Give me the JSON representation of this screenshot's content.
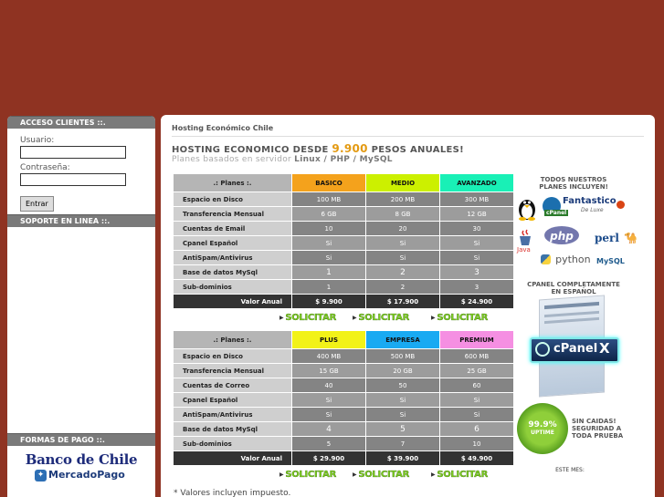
{
  "sidebar": {
    "access_title": "ACCESO CLIENTES ::.",
    "user_label": "Usuario:",
    "password_label": "Contraseña:",
    "user_value": "",
    "password_value": "",
    "login_button": "Entrar",
    "support_title": "SOPORTE EN LINEA ::.",
    "payment_title": "FORMAS DE PAGO ::.",
    "bank_logo": "Banco de Chile",
    "mercadopago_logo": "MercadoPago"
  },
  "main": {
    "breadcrumb": "Hosting Económico Chile",
    "headline_before": "HOSTING ECONOMICO DESDE ",
    "headline_price": "9.900",
    "headline_after": " PESOS ANUALES!",
    "subtitle_before": "Planes basados en servidor ",
    "subtitle_bold": "Linux / PHP / MySQL",
    "footnote": "* Valores incluyen impuesto."
  },
  "table1": {
    "header_label": ".: Planes :.",
    "plans": [
      "BASICO",
      "MEDIO",
      "AVANZADO"
    ],
    "plan_colors": [
      "#f4a21c",
      "#ccf000",
      "#19f0b6"
    ],
    "rows": [
      {
        "label": "Espacio en Disco",
        "values": [
          "100 MB",
          "200 MB",
          "300 MB"
        ]
      },
      {
        "label": "Transferencia Mensual",
        "values": [
          "6 GB",
          "8 GB",
          "12 GB"
        ]
      },
      {
        "label": "Cuentas de Email",
        "values": [
          "10",
          "20",
          "30"
        ]
      },
      {
        "label": "Cpanel Español",
        "values": [
          "Si",
          "Si",
          "Si"
        ]
      },
      {
        "label": "AntiSpam/Antivirus",
        "values": [
          "Si",
          "Si",
          "Si"
        ]
      },
      {
        "label": "Base de datos MySql",
        "values": [
          "1",
          "2",
          "3"
        ]
      },
      {
        "label": "Sub-dominios",
        "values": [
          "1",
          "2",
          "3"
        ]
      }
    ],
    "total_label": "Valor Anual",
    "totals": [
      "$ 9.900",
      "$ 17.900",
      "$ 24.900"
    ]
  },
  "table2": {
    "header_label": ".: Planes :.",
    "plans": [
      "PLUS",
      "EMPRESA",
      "PREMIUM"
    ],
    "plan_colors": [
      "#f2f218",
      "#19aaf2",
      "#f58fe2"
    ],
    "rows": [
      {
        "label": "Espacio en Disco",
        "values": [
          "400 MB",
          "500 MB",
          "600 MB"
        ]
      },
      {
        "label": "Transferencia Mensual",
        "values": [
          "15 GB",
          "20 GB",
          "25 GB"
        ]
      },
      {
        "label": "Cuentas de Correo",
        "values": [
          "40",
          "50",
          "60"
        ]
      },
      {
        "label": "Cpanel Español",
        "values": [
          "Si",
          "Si",
          "Si"
        ]
      },
      {
        "label": "AntiSpam/Antivirus",
        "values": [
          "Si",
          "Si",
          "Si"
        ]
      },
      {
        "label": "Base de datos MySql",
        "values": [
          "4",
          "5",
          "6"
        ]
      },
      {
        "label": "Sub-dominios",
        "values": [
          "5",
          "7",
          "10"
        ]
      }
    ],
    "total_label": "Valor Anual",
    "totals": [
      "$ 29.900",
      "$ 39.900",
      "$ 49.900"
    ]
  },
  "solicitar_label": "SOLICITAR",
  "right": {
    "includes_title_1": "TODOS NUESTROS",
    "includes_title_2": "PLANES INCLUYEN!",
    "fantastico": "Fantastico",
    "deluxe": "De Luxe",
    "cpanel_small": "cPanel",
    "php": "php",
    "perl": "perl",
    "java": "Java",
    "python": "python",
    "mysql": "MySQL",
    "cpanel_title_1": "CPANEL COMPLETAMENTE",
    "cpanel_title_2": "EN ESPAÑOL",
    "cpanel_logo": "cPanel",
    "cpanel_x": "X",
    "uptime_value": "99.9%",
    "uptime_label": "UPTIME",
    "sin_caidas_1": "SIN CAIDAS!",
    "sin_caidas_2": "SEGURIDAD A",
    "sin_caidas_3": "TODA PRUEBA",
    "este_mes": "ESTE MES:"
  }
}
